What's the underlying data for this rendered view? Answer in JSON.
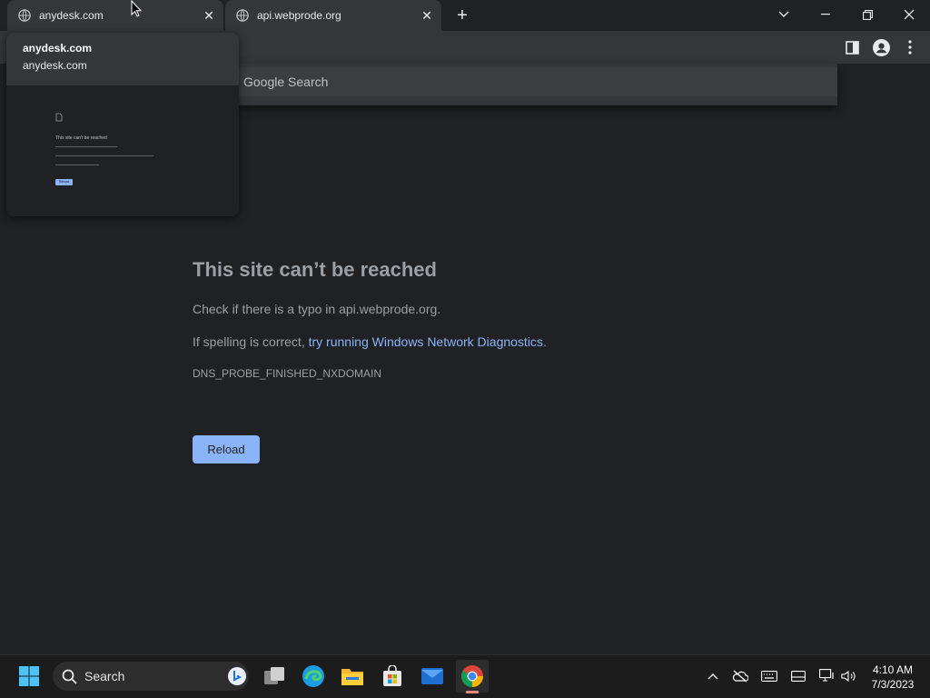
{
  "tabs": [
    {
      "title": "anydesk.com",
      "active": true
    },
    {
      "title": "api.webprode.org",
      "active": false
    }
  ],
  "hover_card": {
    "title": "anydesk.com",
    "domain": "anydesk.com",
    "thumbnail": {
      "title": "This site can't be reached",
      "button": "Reload"
    }
  },
  "omnibox_dropdown": {
    "suggestion": "Google Search"
  },
  "error_page": {
    "title": "This site can’t be reached",
    "check_text": "Check if there is a typo in api.webprode.org.",
    "spelling_prefix": "If spelling is correct, ",
    "spelling_link": "try running Windows Network Diagnostics",
    "spelling_suffix": ".",
    "error_code": "DNS_PROBE_FINISHED_NXDOMAIN",
    "reload_label": "Reload"
  },
  "taskbar": {
    "search_label": "Search",
    "time": "4:10 AM",
    "date": "7/3/2023",
    "apps": [
      "start-icon",
      "task-view-icon",
      "edge-icon",
      "file-explorer-icon",
      "microsoft-store-icon",
      "mail-icon",
      "chrome-icon"
    ]
  },
  "colors": {
    "accent_link": "#8ab4f8",
    "page_bg": "#202124",
    "tab_bg": "#35363a"
  }
}
